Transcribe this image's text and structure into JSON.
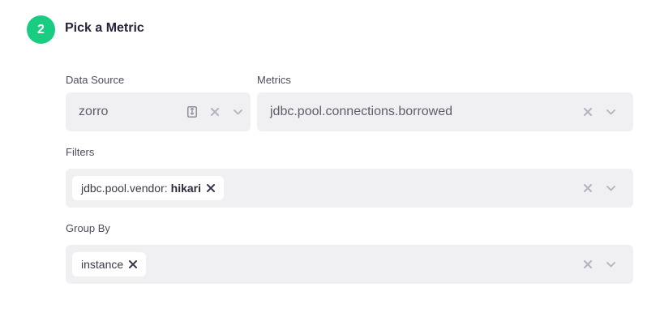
{
  "step": {
    "number": "2",
    "title": "Pick a Metric"
  },
  "data_source": {
    "label": "Data Source",
    "value": "zorro"
  },
  "metrics": {
    "label": "Metrics",
    "value": "jdbc.pool.connections.borrowed"
  },
  "filters": {
    "label": "Filters",
    "chips": [
      {
        "key": "jdbc.pool.vendor:",
        "value": "hikari"
      }
    ]
  },
  "group_by": {
    "label": "Group By",
    "chips": [
      {
        "value": "instance"
      }
    ]
  },
  "colors": {
    "accent": "#18cc82",
    "field_bg": "#f0f0f3",
    "icon": "#b3b2be"
  },
  "icons": [
    "database-icon",
    "clear-icon",
    "chevron-down-icon",
    "chip-remove-icon"
  ]
}
